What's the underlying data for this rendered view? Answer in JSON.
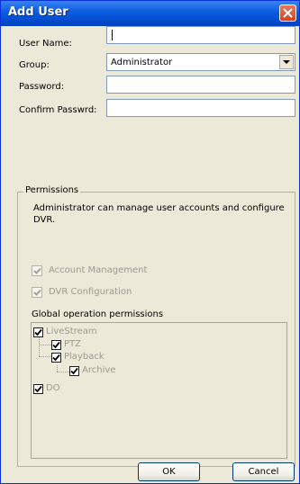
{
  "window": {
    "title": "Add User"
  },
  "form": {
    "username_label": "User Name:",
    "username_value": "",
    "group_label": "Group:",
    "group_value": "Administrator",
    "password_label": "Password:",
    "confirm_label": "Confirm Passwrd:"
  },
  "permissions": {
    "legend": "Permissions",
    "description": "Administrator can manage user accounts and configure DVR.",
    "options": [
      {
        "label": "Account Management",
        "checked": true,
        "enabled": false
      },
      {
        "label": "DVR Configuration",
        "checked": true,
        "enabled": false
      }
    ],
    "global_label": "Global operation permissions",
    "tree": [
      {
        "label": "LiveStream",
        "checked": true
      },
      {
        "label": "PTZ",
        "checked": true
      },
      {
        "label": "Playback",
        "checked": true
      },
      {
        "label": "Archive",
        "checked": true
      },
      {
        "label": "DO",
        "checked": true
      }
    ]
  },
  "buttons": {
    "ok": "OK",
    "cancel": "Cancel"
  },
  "colors": {
    "titlebar": "#0a5ce0",
    "dialog_bg": "#ece9d8",
    "close_button": "#d9401f"
  }
}
